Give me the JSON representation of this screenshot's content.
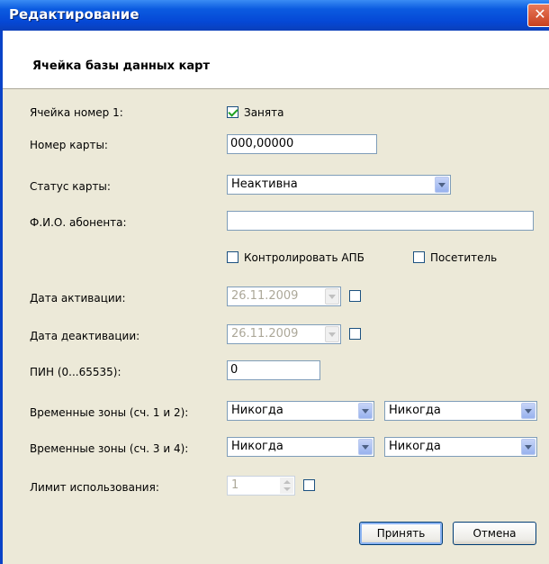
{
  "window": {
    "title": "Редактирование",
    "close_glyph": "✕"
  },
  "header": {
    "title": "Ячейка базы данных карт"
  },
  "form": {
    "cell_label": "Ячейка номер 1:",
    "occupied": {
      "label": "Занята",
      "checked": true
    },
    "card_number": {
      "label": "Номер карты:",
      "value": "000,00000"
    },
    "card_status": {
      "label": "Статус карты:",
      "value": "Неактивна"
    },
    "subscriber_name": {
      "label": "Ф.И.О. абонента:",
      "value": ""
    },
    "control_apb": {
      "label": "Контролировать АПБ",
      "checked": false
    },
    "visitor": {
      "label": "Посетитель",
      "checked": false
    },
    "activation_date": {
      "label": "Дата активации:",
      "value": "26.11.2009",
      "enabled_checked": false
    },
    "deactivation_date": {
      "label": "Дата деактивации:",
      "value": "26.11.2009",
      "enabled_checked": false
    },
    "pin": {
      "label": "ПИН (0...65535):",
      "value": "0"
    },
    "time_zones_12": {
      "label": "Временные зоны (сч. 1 и 2):",
      "zone1": "Никогда",
      "zone2": "Никогда"
    },
    "time_zones_34": {
      "label": "Временные зоны (сч. 3 и 4):",
      "zone3": "Никогда",
      "zone4": "Никогда"
    },
    "usage_limit": {
      "label": "Лимит использования:",
      "value": "1",
      "enabled_checked": false
    }
  },
  "buttons": {
    "accept": "Принять",
    "cancel": "Отмена"
  },
  "colors": {
    "titlebar": "#0548D6",
    "dialog_bg": "#ECE9D8",
    "check_green": "#21A121"
  }
}
